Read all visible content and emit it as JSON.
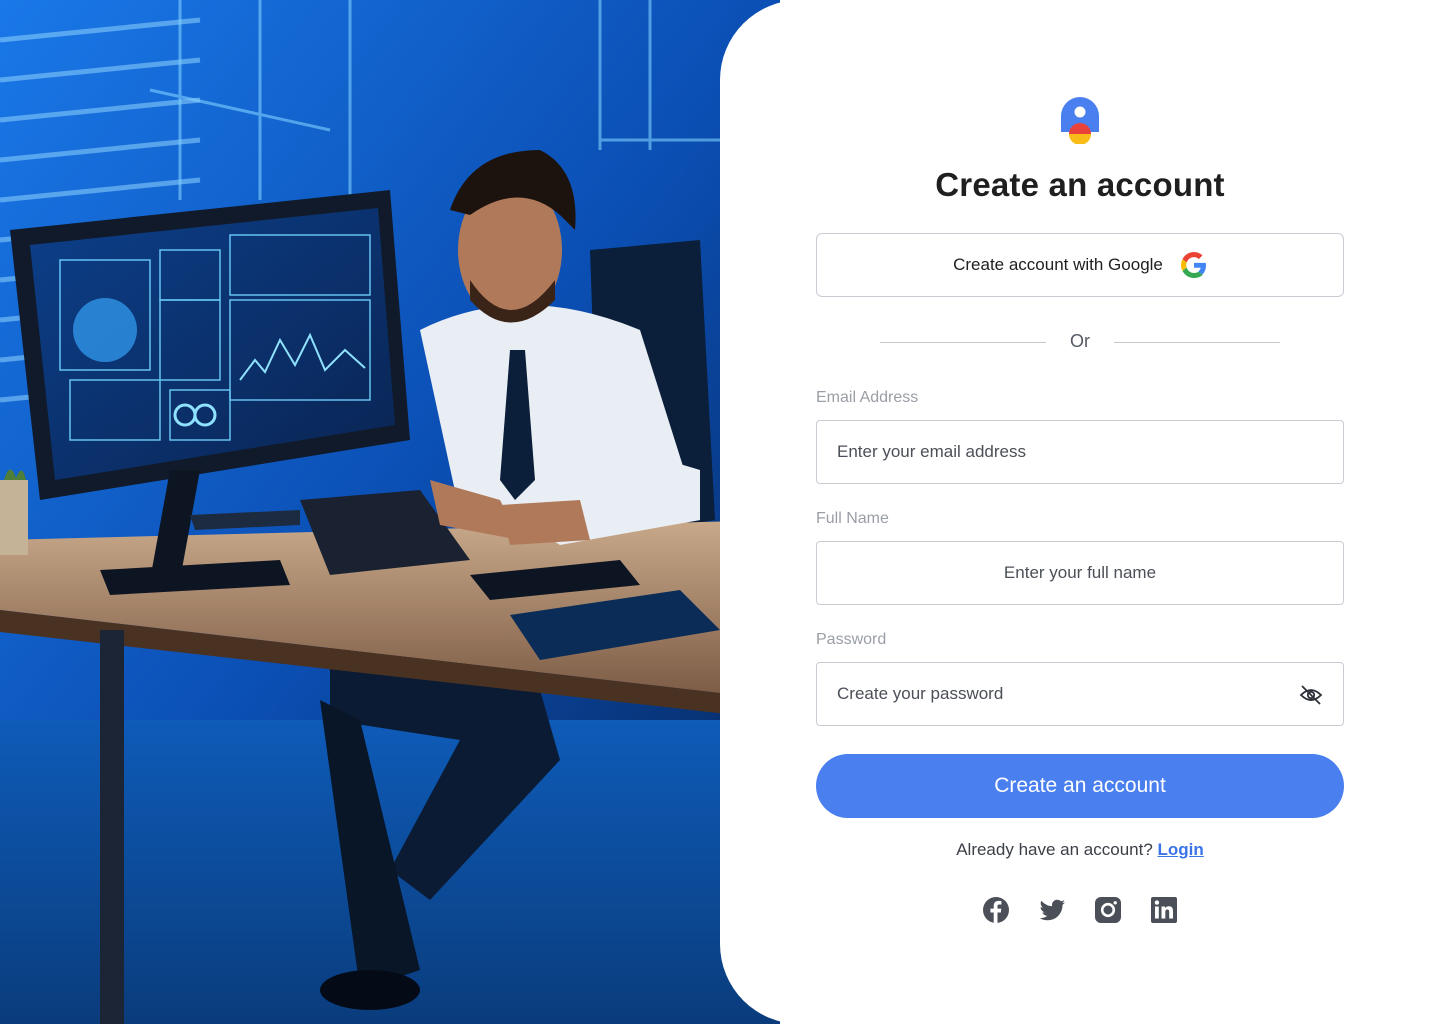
{
  "brand": {
    "colors": {
      "primary": "#4a7ff0",
      "link": "#3b74e8",
      "logo_blue": "#4a7ff0",
      "logo_red": "#e8423a",
      "logo_yellow": "#f9bd1a"
    }
  },
  "title": "Create an account",
  "google": {
    "label": "Create account with Google",
    "icon": "google-g-icon"
  },
  "divider": {
    "text": "Or"
  },
  "form": {
    "email": {
      "label": "Email Address",
      "placeholder": "Enter your email address"
    },
    "full_name": {
      "label": "Full Name",
      "placeholder": "Enter your full name"
    },
    "password": {
      "label": "Password",
      "placeholder": "Create your password",
      "toggle_icon": "eye-off-icon"
    }
  },
  "submit": {
    "label": "Create an account"
  },
  "signin": {
    "prompt": "Already have an account?",
    "link": "Login"
  },
  "socials": [
    {
      "icon": "facebook-icon"
    },
    {
      "icon": "twitter-icon"
    },
    {
      "icon": "instagram-icon"
    },
    {
      "icon": "linkedin-icon"
    }
  ],
  "hero": {
    "icon": "office-worker-illustration"
  }
}
